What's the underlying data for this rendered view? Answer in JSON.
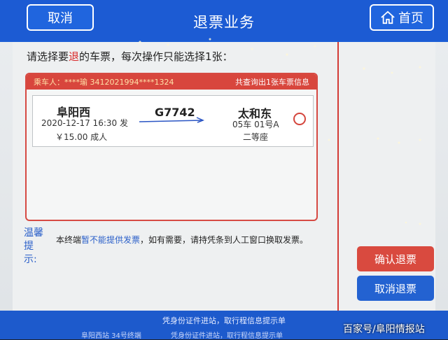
{
  "header": {
    "cancel_label": "取消",
    "title": "退票业务",
    "home_label": "首页"
  },
  "instruction": {
    "prefix": "请选择要",
    "highlight": "退",
    "suffix": "的车票，每次操作只能选择1张："
  },
  "ticket_panel": {
    "passenger": "乘车人：****瑜 3412021994****1324",
    "summary": "共查询出1张车票信息",
    "ticket": {
      "from": "阜阳西",
      "departure": "2020-12-17 16:30 发",
      "price": "￥15.00 成人",
      "train": "G7742",
      "to": "太和东",
      "seat": "05车 01号A",
      "class": "二等座"
    }
  },
  "tips": {
    "label": "温馨提示:",
    "text_prefix": "本终端",
    "text_highlight": "暂不能提供发票",
    "text_suffix": "，如有需要，请持凭条到人工窗口换取发票。"
  },
  "actions": {
    "confirm_label": "确认退票",
    "cancel_label": "取消退票"
  },
  "footer": {
    "line1": "凭身份证件进站，取行程信息提示单",
    "station": "阜阳西站 34号终端",
    "line2": "凭身份证件进站，取行程信息提示单"
  },
  "watermark": "百家号/阜阳情报站",
  "colors": {
    "header_blue": "#1c5bd3",
    "panel_red": "#d8463d",
    "confirm_red": "#d94a3f",
    "cancel_blue": "#2362d1"
  }
}
